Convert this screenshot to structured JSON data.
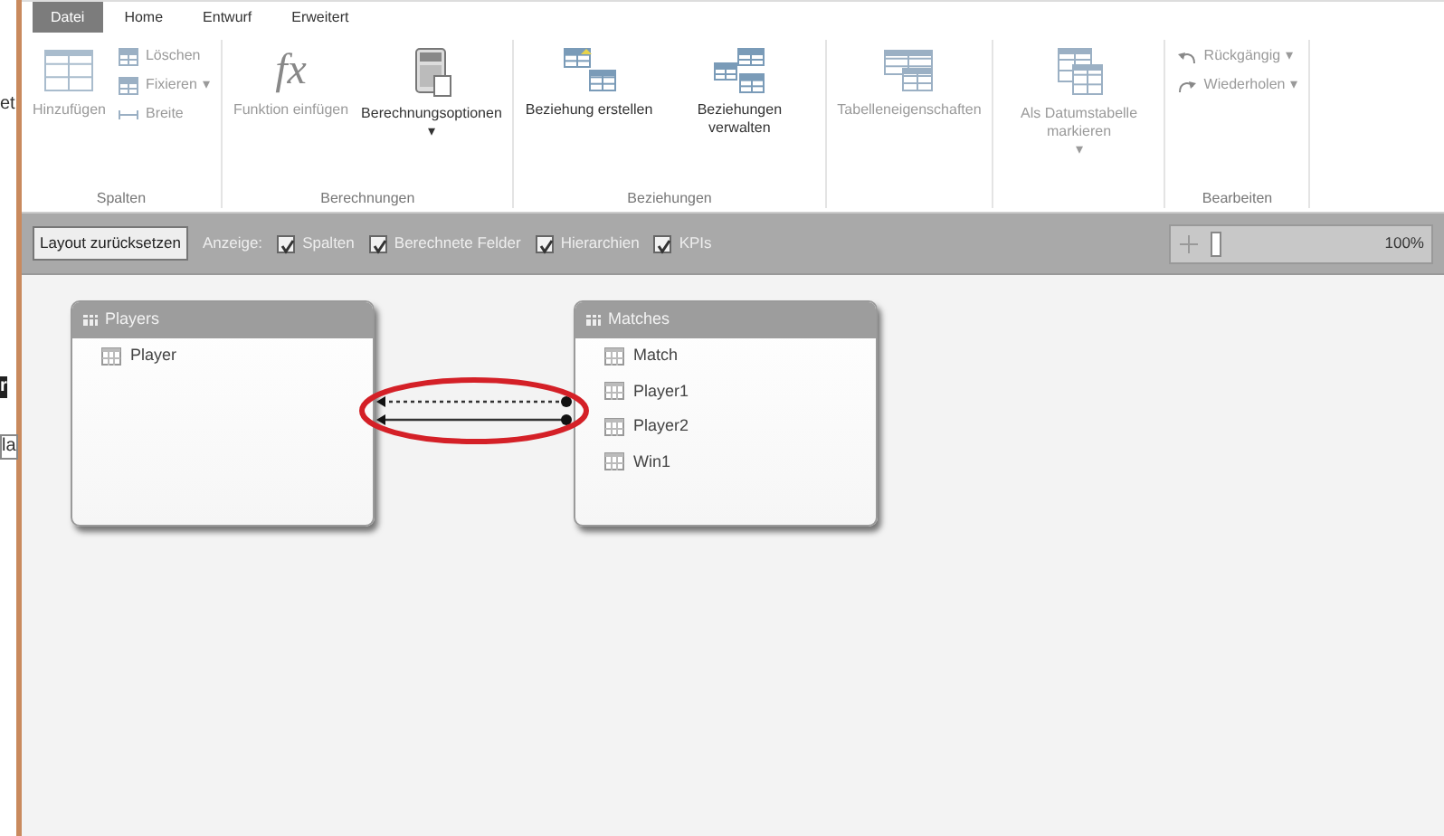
{
  "side_fragments": [
    "et",
    "r",
    "la"
  ],
  "ribbon": {
    "tabs": [
      {
        "label": "Datei",
        "selected": true
      },
      {
        "label": "Home",
        "selected": false
      },
      {
        "label": "Entwurf",
        "selected": false
      },
      {
        "label": "Erweitert",
        "selected": false
      }
    ],
    "groups": [
      {
        "label": "Spalten",
        "items": [
          {
            "kind": "large",
            "label": "Hinzufügen",
            "disabled": true
          },
          {
            "kind": "stack",
            "entries": [
              {
                "label": "Löschen",
                "disabled": true
              },
              {
                "label": "Fixieren",
                "disabled": true,
                "caret": "▾"
              },
              {
                "label": "Breite",
                "disabled": true
              }
            ]
          }
        ]
      },
      {
        "label": "Berechnungen",
        "items": [
          {
            "kind": "large",
            "label": "Funktion einfügen",
            "glyph": "fx",
            "disabled": true
          },
          {
            "kind": "large",
            "label": "Berechnungsoptionen",
            "disabled": false,
            "caret": "▾"
          }
        ]
      },
      {
        "label": "Beziehungen",
        "items": [
          {
            "kind": "large",
            "label": "Beziehung erstellen",
            "disabled": false
          },
          {
            "kind": "large",
            "label": "Beziehungen verwalten",
            "disabled": false
          }
        ]
      },
      {
        "items": [
          {
            "kind": "large",
            "label": "Tabelleneigenschaften",
            "disabled": true
          }
        ]
      },
      {
        "items": [
          {
            "kind": "large",
            "label": "Als Datumstabelle markieren",
            "disabled": true,
            "caret": "▾"
          }
        ]
      },
      {
        "label": "Bearbeiten",
        "items": [
          {
            "kind": "stack",
            "entries": [
              {
                "label": "Rückgängig",
                "disabled": true,
                "caret": "▾"
              },
              {
                "label": "Wiederholen",
                "disabled": true,
                "caret": "▾"
              }
            ]
          }
        ]
      }
    ]
  },
  "toolbar": {
    "reset_button": "Layout zurücksetzen",
    "show_label": "Anzeige:",
    "checkboxes": [
      {
        "label": "Spalten",
        "checked": true
      },
      {
        "label": "Berechnete Felder",
        "checked": true
      },
      {
        "label": "Hierarchien",
        "checked": true
      },
      {
        "label": "KPIs",
        "checked": true
      }
    ],
    "zoom": {
      "reading": "100%"
    }
  },
  "diagram": {
    "tables": [
      {
        "title": "Players",
        "columns": [
          "Player"
        ]
      },
      {
        "title": "Matches",
        "columns": [
          "Match",
          "Player1",
          "Player2",
          "Win1"
        ]
      }
    ],
    "relationships": [
      {
        "kind": "inactive"
      },
      {
        "kind": "active"
      }
    ],
    "annotation": {
      "kind": "ellipse",
      "color": "#d42027"
    }
  }
}
